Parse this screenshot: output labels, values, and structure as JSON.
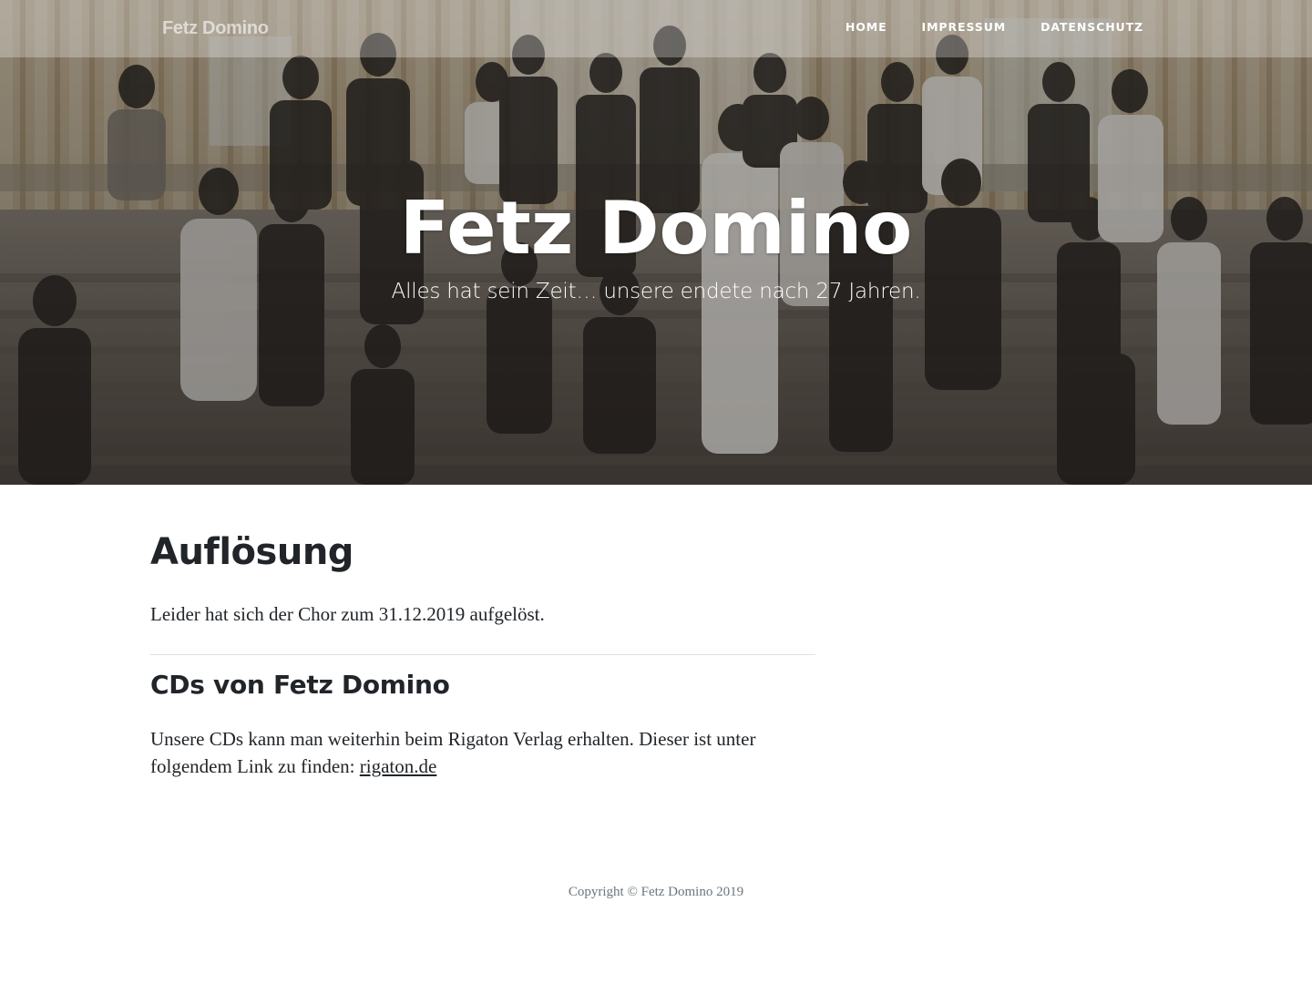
{
  "navbar": {
    "brand": "Fetz Domino",
    "links": [
      {
        "label": "Home"
      },
      {
        "label": "Impressum"
      },
      {
        "label": "Datenschutz"
      }
    ]
  },
  "hero": {
    "title": "Fetz Domino",
    "subtitle": "Alles hat sein Zeit… unsere endete nach 27 Jahren."
  },
  "main": {
    "heading": "Auflösung",
    "intro": "Leider hat sich der Chor zum 31.12.2019 aufgelöst.",
    "cds_heading": "CDs von Fetz Domino",
    "cds_text": "Unsere CDs kann man weiterhin beim Rigaton Verlag erhalten. Dieser ist unter folgendem Link zu finden: ",
    "cds_link": "rigaton.de"
  },
  "footer": {
    "copyright": "Copyright © Fetz Domino 2019"
  },
  "colors": {
    "text": "#212529",
    "muted": "#6c757d",
    "divider": "#dee2e6",
    "nav_text": "#ffffff"
  }
}
